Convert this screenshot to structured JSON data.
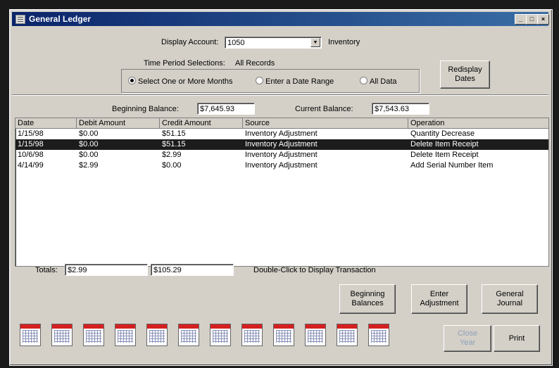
{
  "window": {
    "title": "General Ledger",
    "minimize": "_",
    "maximize": "□",
    "close": "×"
  },
  "account": {
    "label": "Display Account:",
    "value": "1050",
    "name": "Inventory"
  },
  "period": {
    "label": "Time Period Selections:",
    "value": "All Records",
    "options": [
      "Select One or More Months",
      "Enter a Date Range",
      "All Data"
    ],
    "selected_index": 0,
    "redisplay_label": "Redisplay Dates"
  },
  "balances": {
    "beginning_label": "Beginning Balance:",
    "beginning_value": "$7,645.93",
    "current_label": "Current Balance:",
    "current_value": "$7,543.63"
  },
  "table": {
    "columns": [
      "Date",
      "Debit Amount",
      "Credit Amount",
      "Source",
      "Operation"
    ],
    "rows": [
      [
        "1/15/98",
        "$0.00",
        "$51.15",
        "Inventory Adjustment",
        "Quantity Decrease"
      ],
      [
        "1/15/98",
        "$0.00",
        "$51.15",
        "Inventory Adjustment",
        "Delete Item Receipt"
      ],
      [
        "10/6/98",
        "$0.00",
        "$2.99",
        "Inventory Adjustment",
        "Delete Item Receipt"
      ],
      [
        "4/14/99",
        "$2.99",
        "$0.00",
        "Inventory Adjustment",
        "Add Serial Number Item"
      ]
    ],
    "selected_row": 1
  },
  "totals": {
    "label": "Totals:",
    "debit": "$2.99",
    "credit": "$105.29",
    "hint": "Double-Click to Display Transaction"
  },
  "buttons": {
    "beginning_balances": "Beginning Balances",
    "enter_adjustment": "Enter Adjustment",
    "general_journal": "General Journal",
    "close_year": "Close Year",
    "print": "Print"
  },
  "month_icons": [
    "calendar-icon",
    "calendar-icon",
    "calendar-icon",
    "calendar-icon",
    "calendar-icon",
    "calendar-icon",
    "calendar-icon",
    "calendar-icon",
    "calendar-icon",
    "calendar-icon",
    "calendar-icon",
    "calendar-icon"
  ],
  "colors": {
    "title_start": "#0a246a",
    "title_end": "#3a6ea5",
    "selection": "#1c1c1c",
    "face": "#d4d0c8"
  }
}
